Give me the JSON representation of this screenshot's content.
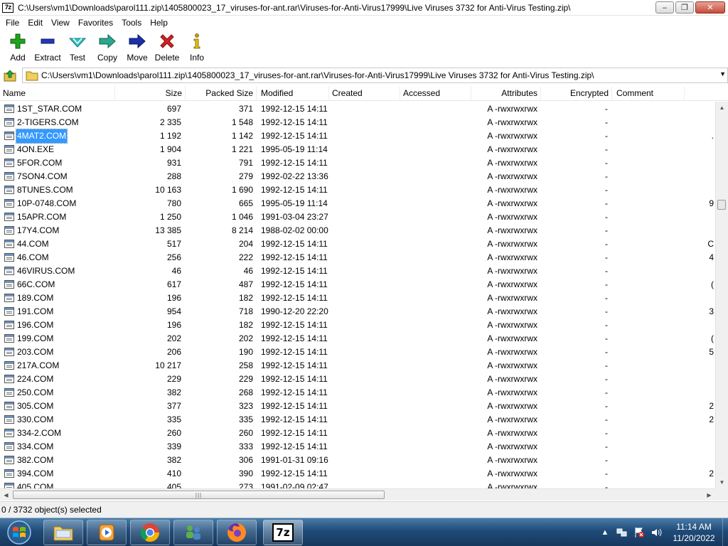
{
  "window": {
    "app_icon": "7z",
    "title": "C:\\Users\\vm1\\Downloads\\parol111.zip\\1405800023_17_viruses-for-ant.rar\\Viruses-for-Anti-Virus17999\\Live Viruses 3732 for Anti-Virus Testing.zip\\"
  },
  "menu": [
    "File",
    "Edit",
    "View",
    "Favorites",
    "Tools",
    "Help"
  ],
  "toolbar": [
    {
      "label": "Add",
      "icon": "plus-icon"
    },
    {
      "label": "Extract",
      "icon": "minus-icon"
    },
    {
      "label": "Test",
      "icon": "check-icon"
    },
    {
      "label": "Copy",
      "icon": "copy-arrow-icon"
    },
    {
      "label": "Move",
      "icon": "move-arrow-icon"
    },
    {
      "label": "Delete",
      "icon": "delete-x-icon"
    },
    {
      "label": "Info",
      "icon": "info-icon"
    }
  ],
  "address": {
    "path": "C:\\Users\\vm1\\Downloads\\parol111.zip\\1405800023_17_viruses-for-ant.rar\\Viruses-for-Anti-Virus17999\\Live Viruses 3732 for Anti-Virus Testing.zip\\"
  },
  "columns": [
    "Name",
    "Size",
    "Packed Size",
    "Modified",
    "Created",
    "Accessed",
    "Attributes",
    "Encrypted",
    "Comment"
  ],
  "rows": [
    {
      "name": "1ST_STAR.COM",
      "size": "697",
      "packed": "371",
      "modified": "1992-12-15 14:11",
      "attributes": "A -rwxrwxrwx",
      "encrypted": "-",
      "comment": ""
    },
    {
      "name": "2-TIGERS.COM",
      "size": "2 335",
      "packed": "1 548",
      "modified": "1992-12-15 14:11",
      "attributes": "A -rwxrwxrwx",
      "encrypted": "-",
      "comment": ""
    },
    {
      "name": "4MAT2.COM",
      "size": "1 192",
      "packed": "1 142",
      "modified": "1992-12-15 14:11",
      "attributes": "A -rwxrwxrwx",
      "encrypted": "-",
      "comment": ".",
      "selected": true
    },
    {
      "name": "4ON.EXE",
      "size": "1 904",
      "packed": "1 221",
      "modified": "1995-05-19 11:14",
      "attributes": "A -rwxrwxrwx",
      "encrypted": "-",
      "comment": ""
    },
    {
      "name": "5FOR.COM",
      "size": "931",
      "packed": "791",
      "modified": "1992-12-15 14:11",
      "attributes": "A -rwxrwxrwx",
      "encrypted": "-",
      "comment": ""
    },
    {
      "name": "7SON4.COM",
      "size": "288",
      "packed": "279",
      "modified": "1992-02-22 13:36",
      "attributes": "A -rwxrwxrwx",
      "encrypted": "-",
      "comment": ""
    },
    {
      "name": "8TUNES.COM",
      "size": "10 163",
      "packed": "1 690",
      "modified": "1992-12-15 14:11",
      "attributes": "A -rwxrwxrwx",
      "encrypted": "-",
      "comment": ""
    },
    {
      "name": "10P-0748.COM",
      "size": "780",
      "packed": "665",
      "modified": "1995-05-19 11:14",
      "attributes": "A -rwxrwxrwx",
      "encrypted": "-",
      "comment": "9"
    },
    {
      "name": "15APR.COM",
      "size": "1 250",
      "packed": "1 046",
      "modified": "1991-03-04 23:27",
      "attributes": "A -rwxrwxrwx",
      "encrypted": "-",
      "comment": ""
    },
    {
      "name": "17Y4.COM",
      "size": "13 385",
      "packed": "8 214",
      "modified": "1988-02-02 00:00",
      "attributes": "A -rwxrwxrwx",
      "encrypted": "-",
      "comment": ""
    },
    {
      "name": "44.COM",
      "size": "517",
      "packed": "204",
      "modified": "1992-12-15 14:11",
      "attributes": "A -rwxrwxrwx",
      "encrypted": "-",
      "comment": "C"
    },
    {
      "name": "46.COM",
      "size": "256",
      "packed": "222",
      "modified": "1992-12-15 14:11",
      "attributes": "A -rwxrwxrwx",
      "encrypted": "-",
      "comment": "4"
    },
    {
      "name": "46VIRUS.COM",
      "size": "46",
      "packed": "46",
      "modified": "1992-12-15 14:11",
      "attributes": "A -rwxrwxrwx",
      "encrypted": "-",
      "comment": ""
    },
    {
      "name": "66C.COM",
      "size": "617",
      "packed": "487",
      "modified": "1992-12-15 14:11",
      "attributes": "A -rwxrwxrwx",
      "encrypted": "-",
      "comment": "("
    },
    {
      "name": "189.COM",
      "size": "196",
      "packed": "182",
      "modified": "1992-12-15 14:11",
      "attributes": "A -rwxrwxrwx",
      "encrypted": "-",
      "comment": ""
    },
    {
      "name": "191.COM",
      "size": "954",
      "packed": "718",
      "modified": "1990-12-20 22:20",
      "attributes": "A -rwxrwxrwx",
      "encrypted": "-",
      "comment": "3"
    },
    {
      "name": "196.COM",
      "size": "196",
      "packed": "182",
      "modified": "1992-12-15 14:11",
      "attributes": "A -rwxrwxrwx",
      "encrypted": "-",
      "comment": ""
    },
    {
      "name": "199.COM",
      "size": "202",
      "packed": "202",
      "modified": "1992-12-15 14:11",
      "attributes": "A -rwxrwxrwx",
      "encrypted": "-",
      "comment": "("
    },
    {
      "name": "203.COM",
      "size": "206",
      "packed": "190",
      "modified": "1992-12-15 14:11",
      "attributes": "A -rwxrwxrwx",
      "encrypted": "-",
      "comment": "5"
    },
    {
      "name": "217A.COM",
      "size": "10 217",
      "packed": "258",
      "modified": "1992-12-15 14:11",
      "attributes": "A -rwxrwxrwx",
      "encrypted": "-",
      "comment": ""
    },
    {
      "name": "224.COM",
      "size": "229",
      "packed": "229",
      "modified": "1992-12-15 14:11",
      "attributes": "A -rwxrwxrwx",
      "encrypted": "-",
      "comment": ""
    },
    {
      "name": "250.COM",
      "size": "382",
      "packed": "268",
      "modified": "1992-12-15 14:11",
      "attributes": "A -rwxrwxrwx",
      "encrypted": "-",
      "comment": ""
    },
    {
      "name": "305.COM",
      "size": "377",
      "packed": "323",
      "modified": "1992-12-15 14:11",
      "attributes": "A -rwxrwxrwx",
      "encrypted": "-",
      "comment": "2"
    },
    {
      "name": "330.COM",
      "size": "335",
      "packed": "335",
      "modified": "1992-12-15 14:11",
      "attributes": "A -rwxrwxrwx",
      "encrypted": "-",
      "comment": "2"
    },
    {
      "name": "334-2.COM",
      "size": "260",
      "packed": "260",
      "modified": "1992-12-15 14:11",
      "attributes": "A -rwxrwxrwx",
      "encrypted": "-",
      "comment": ""
    },
    {
      "name": "334.COM",
      "size": "339",
      "packed": "333",
      "modified": "1992-12-15 14:11",
      "attributes": "A -rwxrwxrwx",
      "encrypted": "-",
      "comment": ""
    },
    {
      "name": "382.COM",
      "size": "382",
      "packed": "306",
      "modified": "1991-01-31 09:16",
      "attributes": "A -rwxrwxrwx",
      "encrypted": "-",
      "comment": ""
    },
    {
      "name": "394.COM",
      "size": "410",
      "packed": "390",
      "modified": "1992-12-15 14:11",
      "attributes": "A -rwxrwxrwx",
      "encrypted": "-",
      "comment": "2"
    },
    {
      "name": "405.COM",
      "size": "405",
      "packed": "273",
      "modified": "1991-02-09 02:47",
      "attributes": "A -rwxrwxrwx",
      "encrypted": "-",
      "comment": ""
    }
  ],
  "status": {
    "text": "0 / 3732 object(s) selected"
  },
  "taskbar": {
    "items": [
      {
        "name": "explorer-task",
        "icon": "folder-icon"
      },
      {
        "name": "media-player-task",
        "icon": "media-player-icon"
      },
      {
        "name": "chrome-task",
        "icon": "chrome-icon"
      },
      {
        "name": "network-task",
        "icon": "network-users-icon"
      },
      {
        "name": "firefox-task",
        "icon": "firefox-icon"
      },
      {
        "name": "sevenzip-task",
        "icon": "7z-icon",
        "label": "7z",
        "active": true
      }
    ],
    "clock_time": "11:14 AM",
    "clock_date": "11/20/2022"
  },
  "colors": {
    "selection": "#3399ff",
    "taskbar": "#1f4b78"
  }
}
